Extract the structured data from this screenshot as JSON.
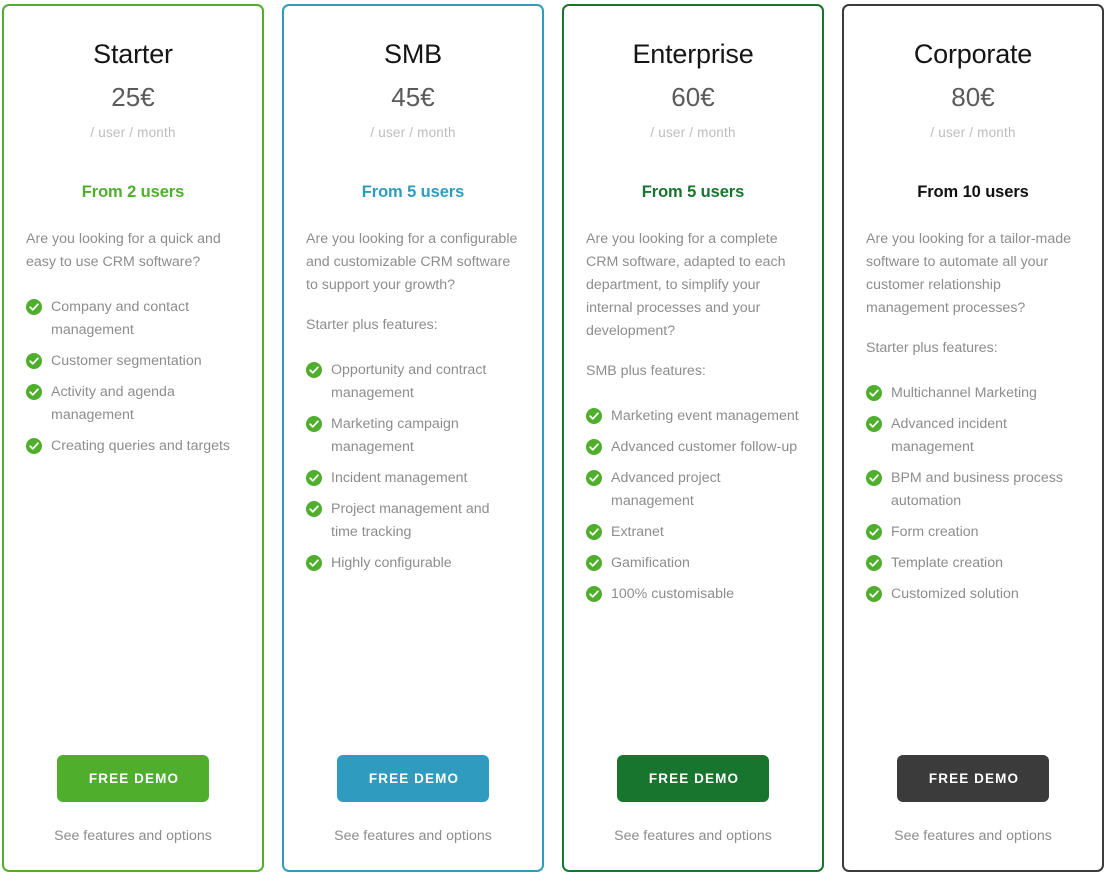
{
  "period_label": "/ user / month",
  "cta_label": "FREE DEMO",
  "footer_link_label": "See features and options",
  "check_icon_name": "check-circle-icon",
  "check_icon_color": "#4FAF2C",
  "plans": [
    {
      "name": "Starter",
      "price": "25€",
      "period": "/ user / month",
      "users": "From 2 users",
      "pitch": "Are you looking for a quick and easy to use CRM software?",
      "plus_line": "",
      "accent": "#4FAF2C",
      "cta": "FREE DEMO",
      "footer": "See features and options",
      "features": [
        "Company and contact management",
        "Customer segmentation",
        "Activity and agenda management",
        "Creating queries and targets"
      ]
    },
    {
      "name": "SMB",
      "price": "45€",
      "period": "/ user / month",
      "users": "From 5 users",
      "pitch": "Are you looking for a configurable and customizable CRM software to support your growth?",
      "plus_line": "Starter plus features:",
      "accent": "#2F9CBF",
      "cta": "FREE DEMO",
      "footer": "See features and options",
      "features": [
        "Opportunity and contract management",
        "Marketing campaign management",
        "Incident management",
        "Project management and time tracking",
        "Highly configurable"
      ]
    },
    {
      "name": "Enterprise",
      "price": "60€",
      "period": "/ user / month",
      "users": "From 5 users",
      "pitch": "Are you looking for a complete CRM software, adapted to each department, to simplify your internal processes and your development?",
      "plus_line": "SMB plus features:",
      "accent": "#18752E",
      "cta": "FREE DEMO",
      "footer": "See features and options",
      "features": [
        "Marketing event management",
        "Advanced customer follow-up",
        "Advanced project management",
        "Extranet",
        "Gamification",
        "100% customisable"
      ]
    },
    {
      "name": "Corporate",
      "price": "80€",
      "period": "/ user / month",
      "users": "From 10 users",
      "pitch": "Are you looking for a tailor-made software to automate all your customer relationship management processes?",
      "plus_line": "Starter plus features:",
      "accent": "#3B3B3B",
      "cta": "FREE DEMO",
      "footer": "See features and options",
      "features": [
        "Multichannel Marketing",
        "Advanced incident management",
        "BPM and business process automation",
        "Form creation",
        "Template creation",
        "Customized solution"
      ]
    }
  ]
}
